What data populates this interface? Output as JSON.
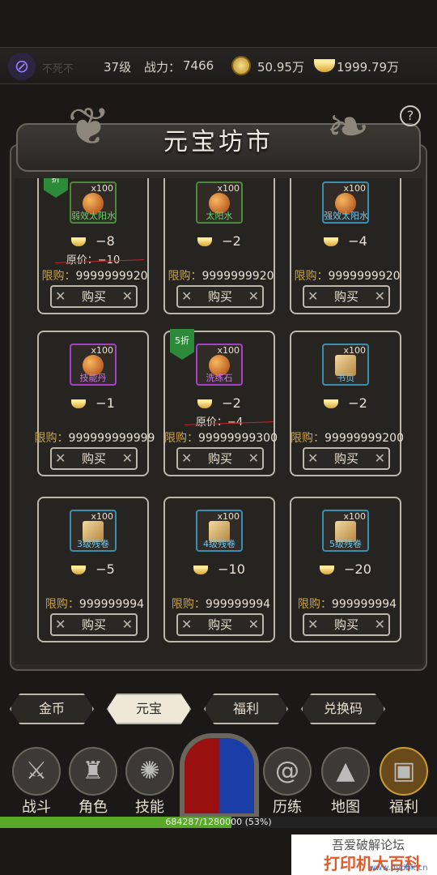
{
  "status": {
    "player_name": "不死不",
    "level": "37级",
    "power_label": "战力：",
    "power": "7466",
    "gold": "50.95万",
    "yuanbao": "1999.79万"
  },
  "shop": {
    "title": "元宝坊市",
    "help": "?",
    "buy_label": "购买",
    "limit_label": "限购：",
    "orig_label": "原价：",
    "items": [
      {
        "name": "弱效太阳水",
        "qty": "x100",
        "price": "−8",
        "orig": "−10",
        "limit": "9999999920",
        "color": "green",
        "badge": "折"
      },
      {
        "name": "太阳水",
        "qty": "x100",
        "price": "−2",
        "orig": "",
        "limit": "9999999920",
        "color": "green",
        "badge": ""
      },
      {
        "name": "强效太阳水",
        "qty": "x100",
        "price": "−4",
        "orig": "",
        "limit": "9999999920",
        "color": "blue",
        "badge": ""
      },
      {
        "name": "技能丹",
        "qty": "x100",
        "price": "−1",
        "orig": "",
        "limit": "999999999999",
        "color": "purple",
        "badge": ""
      },
      {
        "name": "洗练石",
        "qty": "x100",
        "price": "−2",
        "orig": "−4",
        "limit": "99999999300",
        "color": "purple",
        "badge": "5折"
      },
      {
        "name": "书页",
        "qty": "x100",
        "price": "−2",
        "orig": "",
        "limit": "99999999200",
        "color": "blue",
        "badge": ""
      },
      {
        "name": "3级残卷",
        "qty": "x100",
        "price": "−5",
        "orig": "",
        "limit": "999999994",
        "color": "blue",
        "badge": ""
      },
      {
        "name": "4级残卷",
        "qty": "x100",
        "price": "−10",
        "orig": "",
        "limit": "999999994",
        "color": "blue",
        "badge": ""
      },
      {
        "name": "5级残卷",
        "qty": "x100",
        "price": "−20",
        "orig": "",
        "limit": "999999994",
        "color": "blue",
        "badge": ""
      }
    ]
  },
  "tabs": [
    "金币",
    "元宝",
    "福利",
    "兑换码"
  ],
  "active_tab": "元宝",
  "nav": [
    {
      "label": "战斗",
      "icon": "swords-icon"
    },
    {
      "label": "角色",
      "icon": "helmet-icon"
    },
    {
      "label": "技能",
      "icon": "flame-icon"
    },
    {
      "label": "历练",
      "icon": "spiral-icon"
    },
    {
      "label": "地图",
      "icon": "mountain-icon"
    },
    {
      "label": "福利",
      "icon": "chest-icon"
    }
  ],
  "xp": {
    "text": "684287/1280000 (53%)",
    "fraction": 0.53
  },
  "watermark": {
    "line1": "吾爱破解论坛",
    "line2": "打印机大百科",
    "line3": "www.dydbk.cn"
  },
  "colors": {
    "accent": "#c9a24a",
    "xp": "#5aa82a",
    "badge": "#2d8a3a"
  }
}
